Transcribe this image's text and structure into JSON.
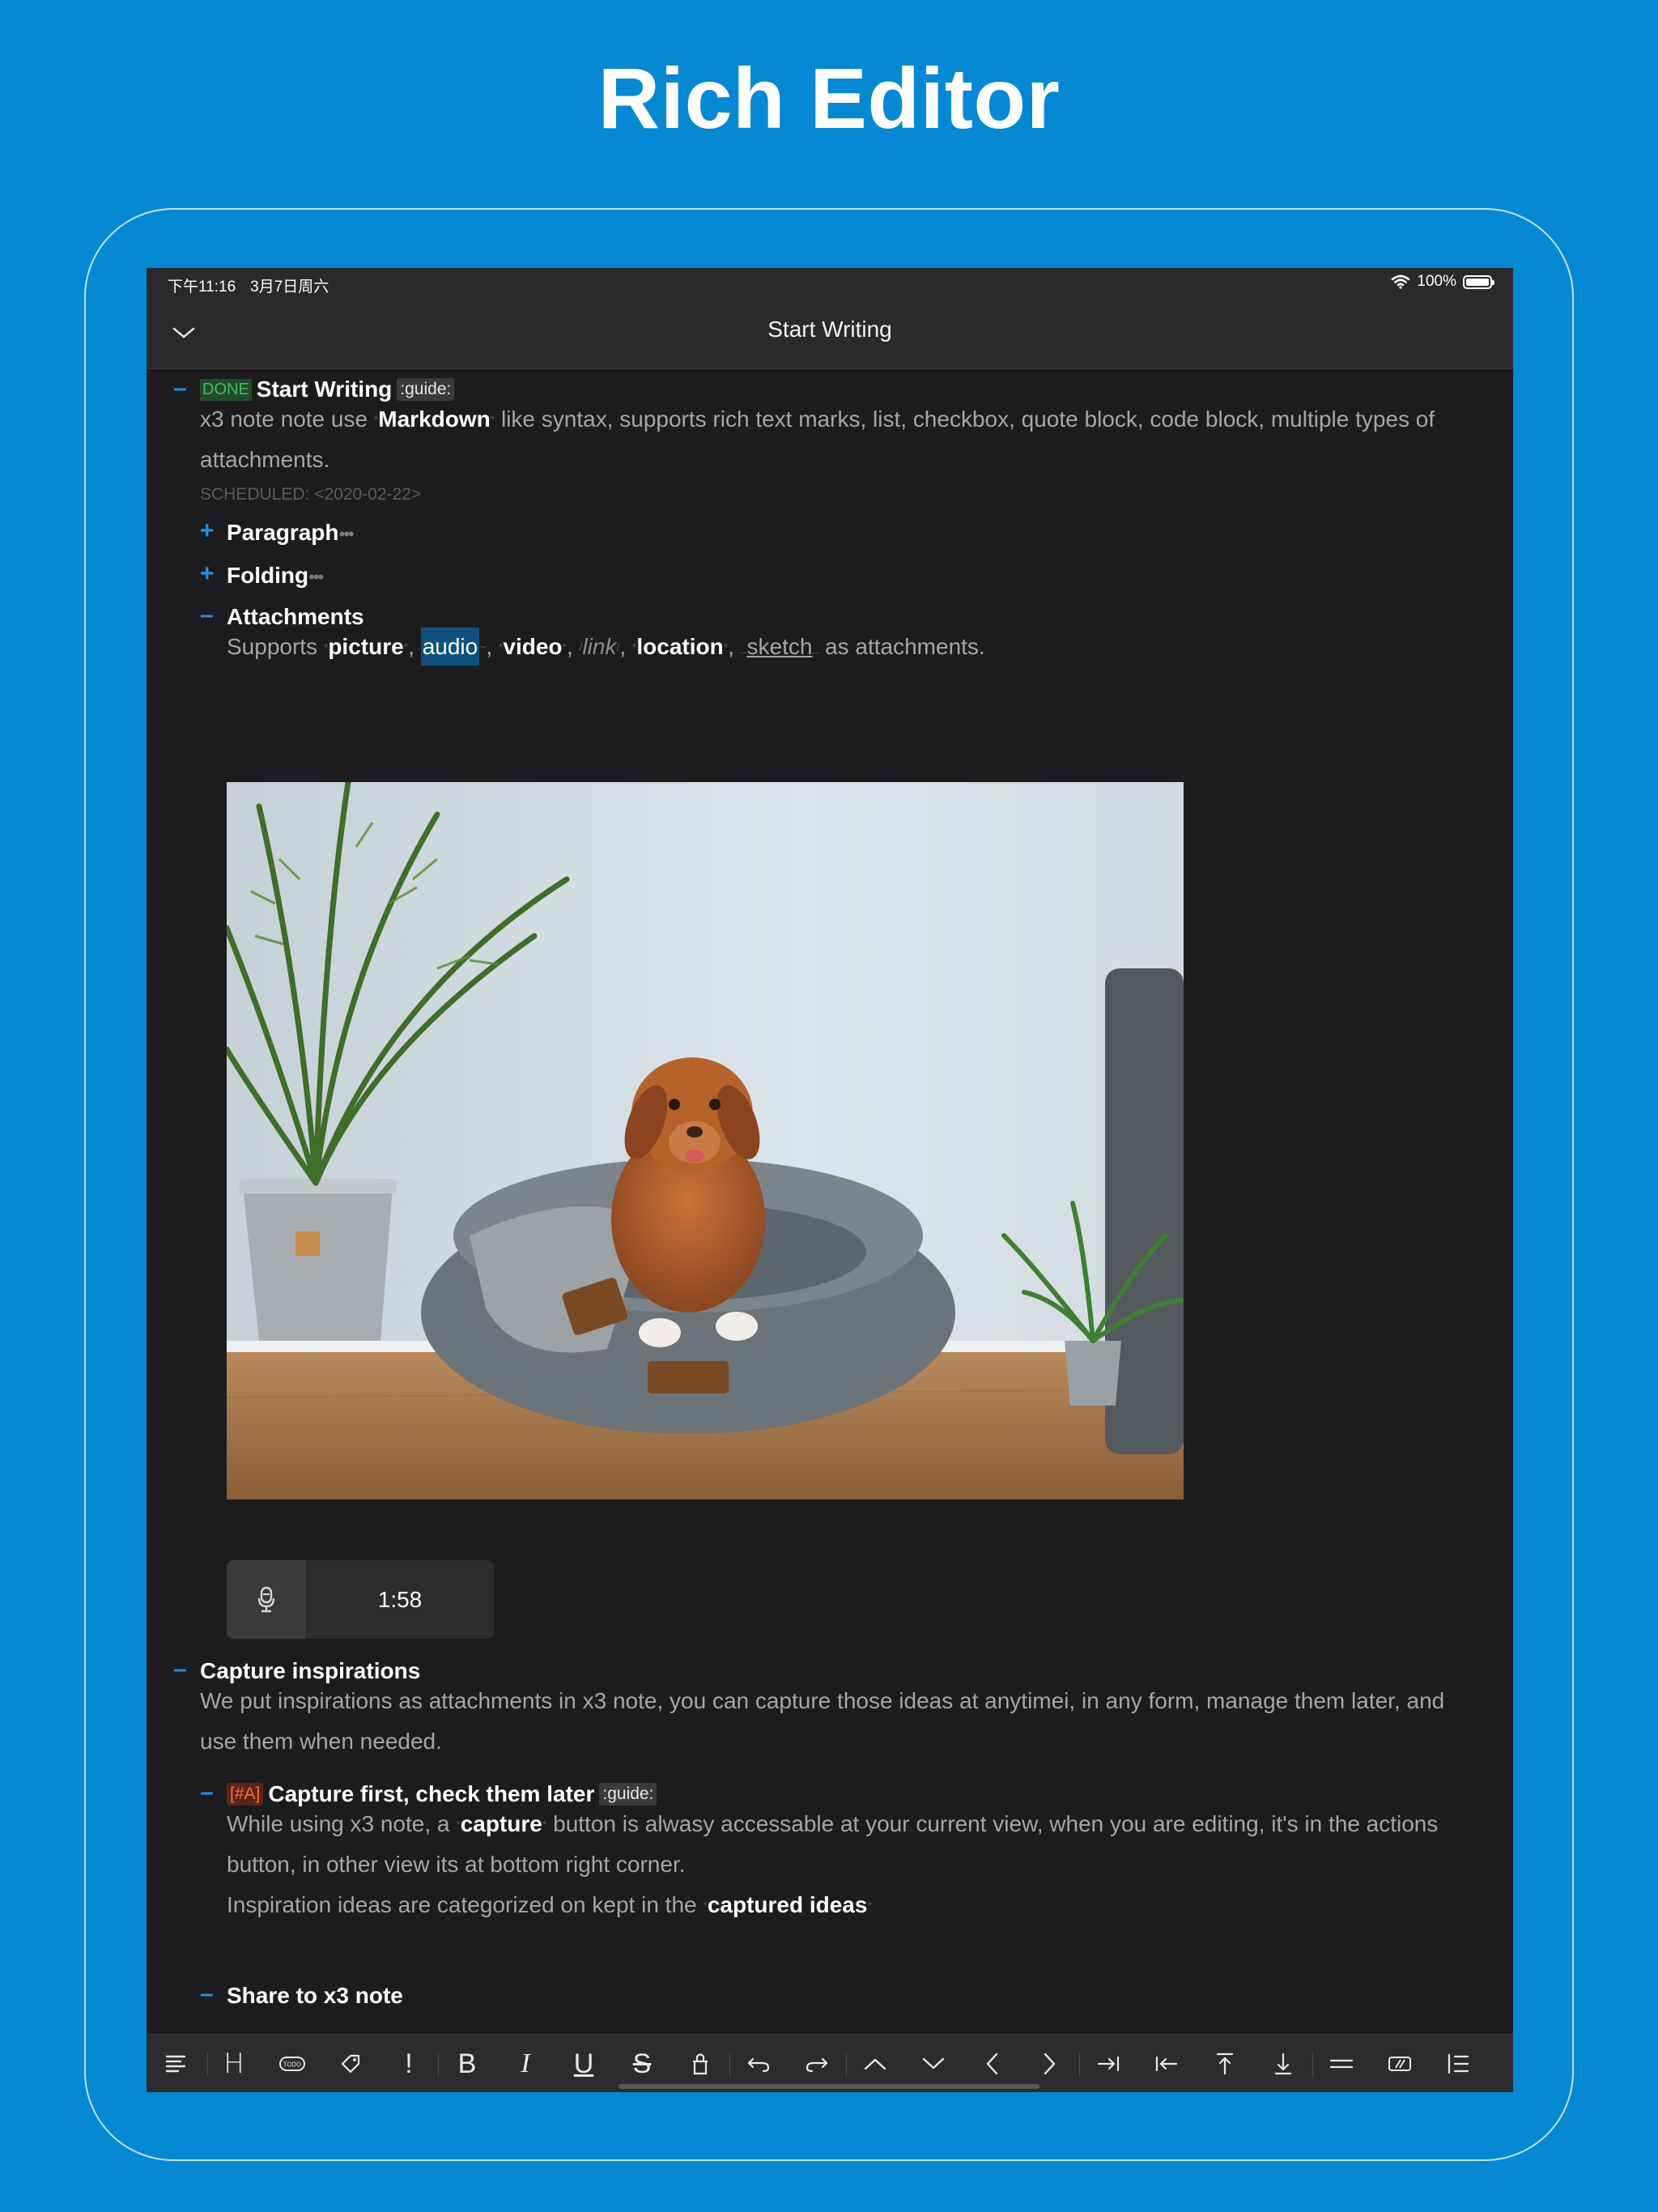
{
  "promo": {
    "title": "Rich Editor"
  },
  "status_bar": {
    "time": "下午11:16",
    "date": "3月7日周六",
    "battery": "100%",
    "battery_level": 1.0
  },
  "nav": {
    "title": "Start Writing"
  },
  "outline": {
    "item1": {
      "done_badge": "DONE",
      "title": "Start Writing",
      "tag": ":guide:",
      "body_prefix": "x3 note note use ",
      "body_bold": "Markdown",
      "body_rest": " like syntax,  supports rich text marks, list, checkbox, quote block, code block, multiple types of",
      "body_line2": "attachments.",
      "scheduled": "SCHEDULED: <2020-02-22>"
    },
    "paragraph": {
      "title": "Paragraph",
      "ellipsis": "•••"
    },
    "folding": {
      "title": "Folding",
      "ellipsis": "•••"
    },
    "attachments": {
      "title": "Attachments",
      "supports": "Supports ",
      "picture": "picture",
      "audio": "audio",
      "video": "video",
      "link": "link",
      "location": "location",
      "sketch": "sketch",
      "comma": ", ",
      "suffix": " as attachments."
    },
    "audio_clip": {
      "duration": "1:58"
    },
    "capture": {
      "title": "Capture inspirations",
      "body_line1": "We put inspirations as attachments in x3 note, you can capture those ideas at anytimei, in any form, manage them later, and",
      "body_line2": "use them when needed."
    },
    "capture_first": {
      "priority": "[#A]",
      "title": "Capture first, check them later",
      "tag": ":guide:",
      "line1_prefix": "While using x3 note,  a ",
      "line1_bold": "capture",
      "line1_rest": " button is alwasy accessable at your current view, when you are editing, it's in the actions",
      "line2": "button, in other view its at bottom right corner.",
      "line3_prefix": "Inspiration ideas are categorized on kept in the ",
      "line3_bold": "captured ideas"
    },
    "share": {
      "title": "Share to x3 note"
    }
  },
  "toolbar": {
    "icons": [
      "align-left-icon",
      "heading-icon",
      "todo-icon",
      "tag-icon",
      "priority-icon",
      "bold-icon",
      "italic-icon",
      "underline-icon",
      "strikethrough-icon",
      "attachment-icon",
      "undo-icon",
      "redo-icon",
      "move-up-icon",
      "move-down-icon",
      "collapse-left-icon",
      "expand-right-icon",
      "indent-icon",
      "outdent-icon",
      "move-top-icon",
      "move-bottom-icon",
      "separator-icon",
      "code-block-icon",
      "ordered-list-icon"
    ],
    "heading_label": "H",
    "priority_label": "!",
    "bold_label": "B",
    "italic_label": "I",
    "underline_label": "U",
    "strike_label": "S",
    "todo_label": "TODO"
  },
  "colors": {
    "background": "#0788d2",
    "screen": "#1c1c1e",
    "accent": "#1e90e6",
    "done": "#3fbf5a",
    "priority": "#ff6a3d",
    "highlight": "#10507f"
  }
}
